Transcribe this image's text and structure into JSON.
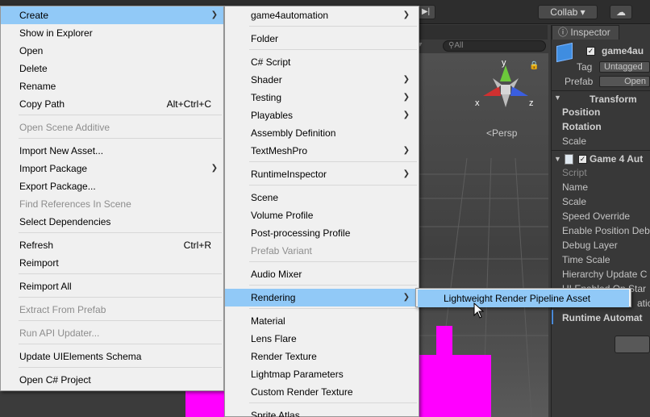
{
  "toolbar": {
    "collab_label": "Collab ▾",
    "step_glyph": "▶|"
  },
  "scene": {
    "search_placeholder": "All",
    "gizmo_text": "os ▾",
    "persp_label": "Persp",
    "axis_y": "y",
    "axis_x": "x",
    "axis_z": "z"
  },
  "inspector": {
    "tab_label": "Inspector",
    "object_name": "game4au",
    "tag_label": "Tag",
    "tag_value": "Untagged",
    "prefab_label": "Prefab",
    "prefab_open": "Open",
    "transform_header": "Transform",
    "transform_fields": [
      "Position",
      "Rotation",
      "Scale"
    ],
    "component_header": "Game 4 Aut",
    "component_fields": [
      "Script",
      "Name",
      "Scale",
      "Speed Override",
      "Enable Position Deb",
      "Debug Layer",
      "Time Scale",
      "Hierarchy Update C",
      "UI Enabled On Star",
      "ation"
    ],
    "runtime_header": "Runtime Automat"
  },
  "main_menu": {
    "items": [
      {
        "label": "Create",
        "submenu": true,
        "highlighted": true
      },
      {
        "label": "Show in Explorer"
      },
      {
        "label": "Open"
      },
      {
        "label": "Delete"
      },
      {
        "label": "Rename"
      },
      {
        "label": "Copy Path",
        "shortcut": "Alt+Ctrl+C"
      },
      {
        "label": "Open Scene Additive",
        "disabled": true
      },
      {
        "label": "Import New Asset..."
      },
      {
        "label": "Import Package",
        "submenu": true
      },
      {
        "label": "Export Package..."
      },
      {
        "label": "Find References In Scene",
        "disabled": true
      },
      {
        "label": "Select Dependencies"
      },
      {
        "label": "Refresh",
        "shortcut": "Ctrl+R"
      },
      {
        "label": "Reimport"
      },
      {
        "label": "Reimport All"
      },
      {
        "label": "Extract From Prefab",
        "disabled": true
      },
      {
        "label": "Run API Updater...",
        "disabled": true
      },
      {
        "label": "Update UIElements Schema"
      },
      {
        "label": "Open C# Project"
      }
    ]
  },
  "create_menu": {
    "items": [
      {
        "label": "game4automation",
        "submenu": true
      },
      {
        "label": "Folder"
      },
      {
        "label": "C# Script"
      },
      {
        "label": "Shader",
        "submenu": true
      },
      {
        "label": "Testing",
        "submenu": true
      },
      {
        "label": "Playables",
        "submenu": true
      },
      {
        "label": "Assembly Definition"
      },
      {
        "label": "TextMeshPro",
        "submenu": true
      },
      {
        "label": "RuntimeInspector",
        "submenu": true
      },
      {
        "label": "Scene"
      },
      {
        "label": "Volume Profile"
      },
      {
        "label": "Post-processing Profile"
      },
      {
        "label": "Prefab Variant",
        "disabled": true
      },
      {
        "label": "Audio Mixer"
      },
      {
        "label": "Rendering",
        "submenu": true,
        "highlighted": true
      },
      {
        "label": "Material"
      },
      {
        "label": "Lens Flare"
      },
      {
        "label": "Render Texture"
      },
      {
        "label": "Lightmap Parameters"
      },
      {
        "label": "Custom Render Texture"
      },
      {
        "label": "Sprite Atlas"
      }
    ]
  },
  "rendering_menu": {
    "items": [
      {
        "label": "Lightweight Render Pipeline Asset",
        "highlighted": true
      }
    ]
  }
}
